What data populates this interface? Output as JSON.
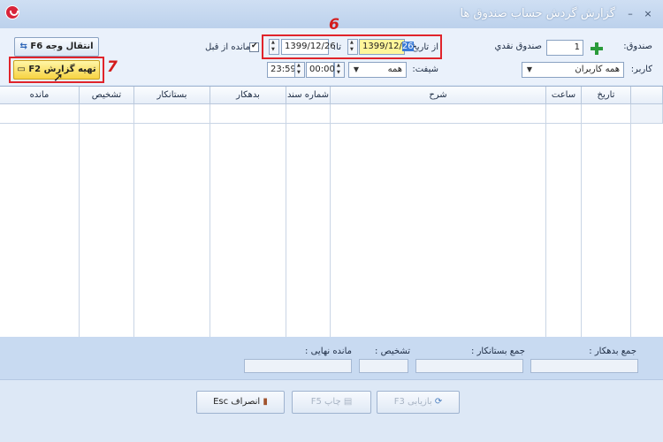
{
  "window": {
    "title": "گزارش گردش حساب صندوق ها",
    "min": "–",
    "close": "×"
  },
  "filters": {
    "cash_label": "صندوق:",
    "cash_value": "1",
    "cash_name": "صندوق نقدي",
    "user_label": "کاربر:",
    "user_value": "همه کاربران",
    "from_label": "از تاریخ :",
    "from_value": "1399/12/",
    "from_value_sel": "26",
    "to_label": "تا:",
    "to_value": "1399/12/26",
    "prev_balance_label": "مانده از قبل",
    "shift_label": "شیفت:",
    "shift_value": "همه",
    "time_from": "00:00",
    "time_to": "23:59"
  },
  "actions": {
    "transfer": "انتقال وجه F6",
    "report": "تهیه گزارش F2",
    "cancel": "انصراف Esc",
    "print": "چاپ F5",
    "reload": "بازیابی F3"
  },
  "annotations": {
    "six": "6",
    "seven": "7"
  },
  "table": {
    "headers": [
      "تاریخ",
      "ساعت",
      "شرح",
      "شماره سند",
      "بدهکار",
      "بستانکار",
      "تشخیص",
      "مانده"
    ]
  },
  "footer": {
    "debit_total": "جمع بدهکار :",
    "credit_total": "جمع بستانکار :",
    "diagnosis": "تشخیص :",
    "final_balance": "مانده نهایی :"
  }
}
